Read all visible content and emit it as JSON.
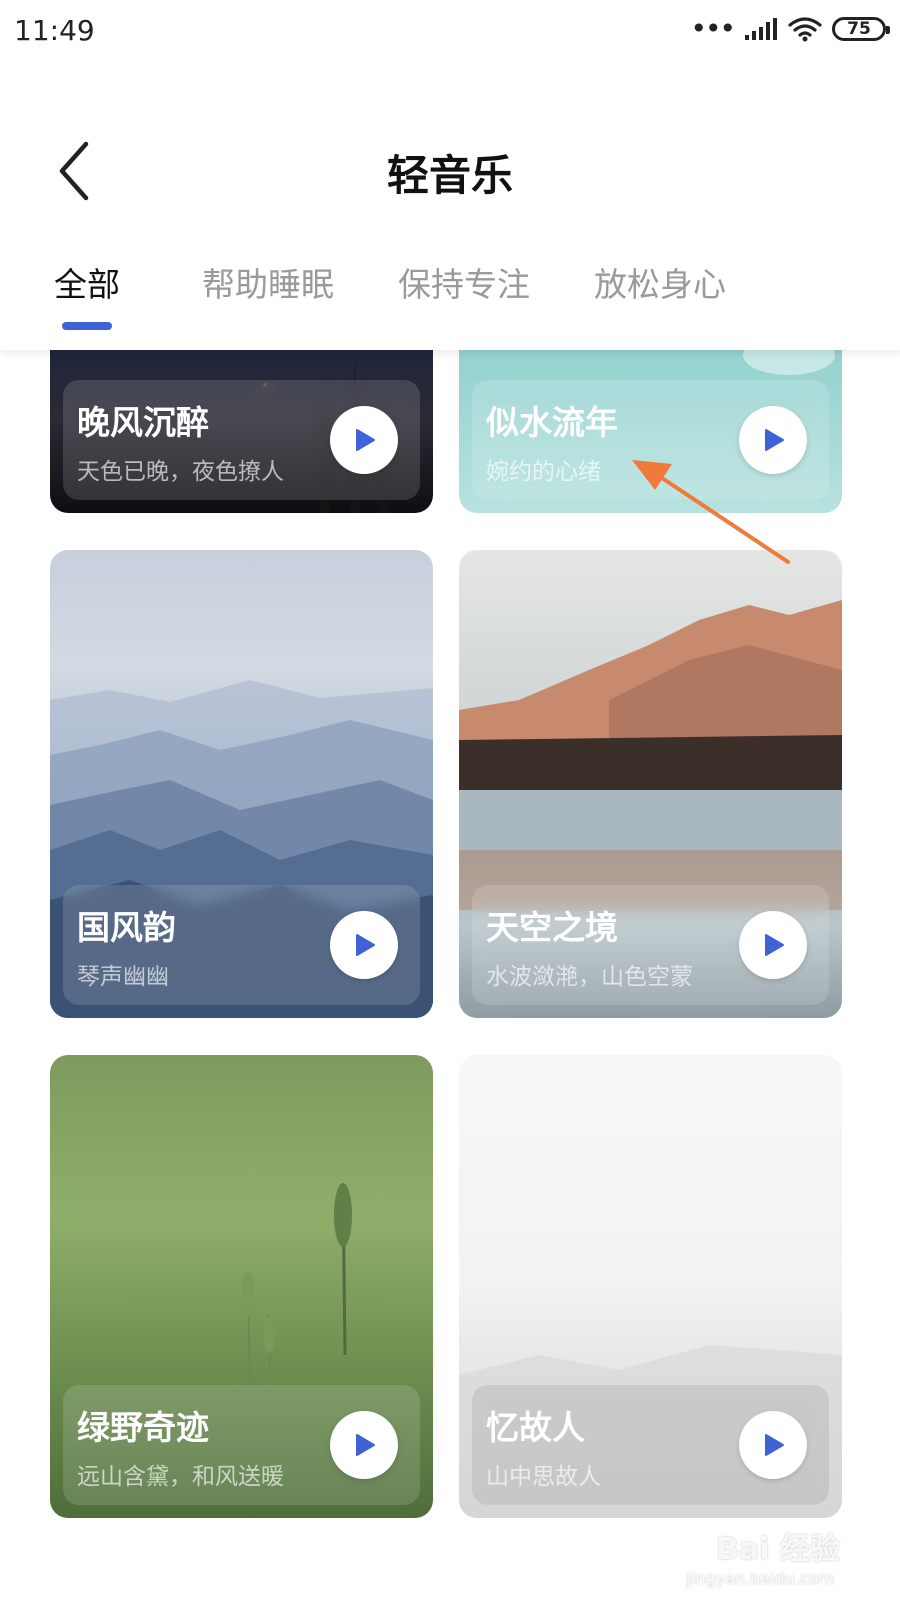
{
  "status_bar": {
    "time": "11:49",
    "battery": "75",
    "icons": [
      "more-dots-icon",
      "cell-signal-icon",
      "wifi-icon",
      "battery-icon"
    ]
  },
  "header": {
    "title": "轻音乐",
    "back_icon": "chevron-left-icon"
  },
  "tabs": [
    {
      "label": "全部",
      "active": true
    },
    {
      "label": "帮助睡眠",
      "active": false
    },
    {
      "label": "保持专注",
      "active": false
    },
    {
      "label": "放松身心",
      "active": false
    }
  ],
  "accent_color": "#3f63d6",
  "cards": [
    {
      "title": "晚风沉醉",
      "subtitle": "天色已晚，夜色撩人",
      "scene": "night-sky"
    },
    {
      "title": "似水流年",
      "subtitle": "婉约的心绪",
      "scene": "teal-water"
    },
    {
      "title": "国风韵",
      "subtitle": "琴声幽幽",
      "scene": "misty-mountains"
    },
    {
      "title": "天空之境",
      "subtitle": "水波潋滟，山色空蒙",
      "scene": "mountain-lake"
    },
    {
      "title": "绿野奇迹",
      "subtitle": "远山含黛，和风送暖",
      "scene": "green-wheat"
    },
    {
      "title": "忆故人",
      "subtitle": "山中思故人",
      "scene": "white-fog"
    }
  ],
  "watermark": {
    "text": "Bai 经验",
    "sub": "jingyan.baidu.com"
  }
}
